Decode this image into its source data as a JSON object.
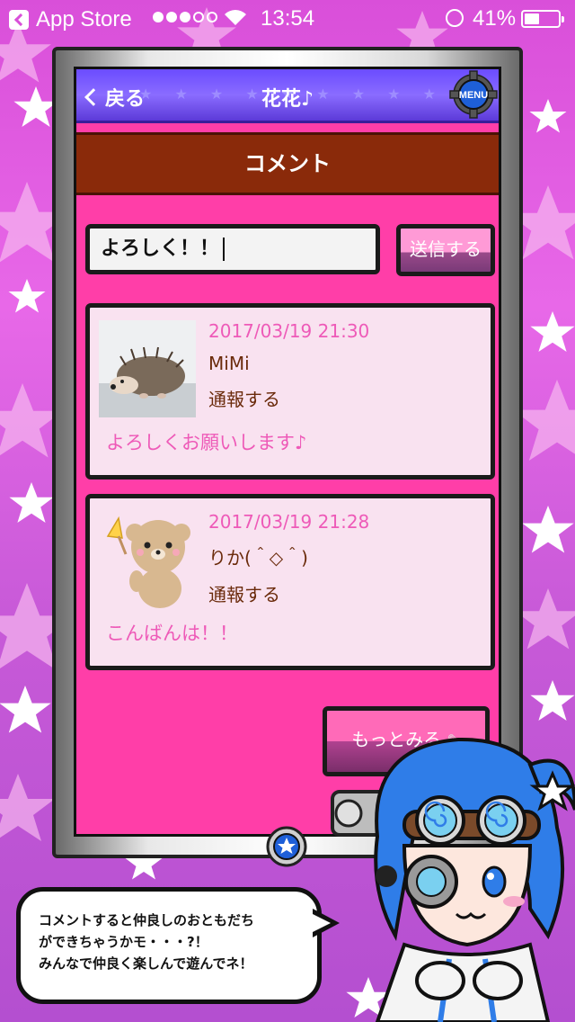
{
  "statusbar": {
    "back_app": "App Store",
    "time": "13:54",
    "battery": "41%"
  },
  "nav": {
    "back_label": "戻る",
    "title": "花花♪",
    "menu_label": "MENU"
  },
  "section": {
    "title": "コメント"
  },
  "composer": {
    "input_value": "よろしく！！",
    "send_label": "送信する"
  },
  "comments": [
    {
      "date": "2017/03/19 21:30",
      "user": "MiMi",
      "report": "通報する",
      "body": "よろしくお願いします♪",
      "avatar": "hedgehog-photo"
    },
    {
      "date": "2017/03/19 21:28",
      "user": "りか(＾◇＾)",
      "report": "通報する",
      "body": "こんばんは！！",
      "avatar": "bear-illustration"
    }
  ],
  "more": {
    "label": "もっとみる"
  },
  "bubble": {
    "line1": "コメントすると仲良しのおともだち",
    "line2": "ができちゃうかモ・・・?！",
    "line3": "みんなで仲良く楽しんで遊んでネ！"
  },
  "colors": {
    "background": "#d94fd9",
    "screen": "#ff3ea8",
    "nav": "#6b4cff",
    "header": "#8a2a0a",
    "card": "#f9e2f0",
    "accent_text": "#ee5ab8",
    "brown_text": "#6a2a0a"
  }
}
